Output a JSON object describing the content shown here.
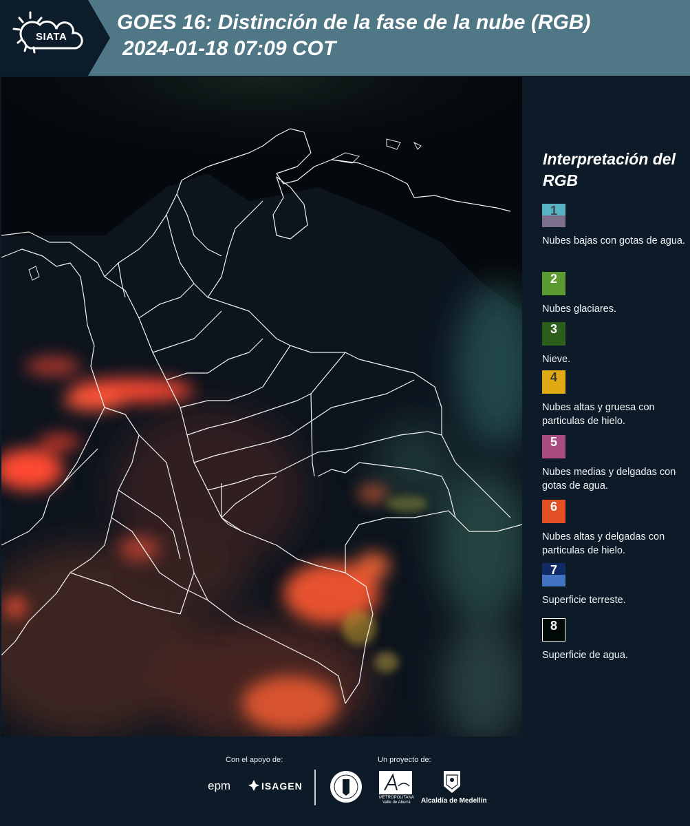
{
  "header": {
    "logo_text": "SIATA",
    "title": "GOES 16: Distinción de la fase de la nube (RGB)",
    "subtitle": "2024-01-18 07:09 COT"
  },
  "legend": {
    "title": "Interpretación del RGB",
    "items": [
      {
        "number": "1",
        "label": "Nubes bajas con gotas de agua.",
        "color_top": "#58b2c2",
        "color_bottom": "#7c6f8c",
        "text_color": "#3d4a55"
      },
      {
        "number": "2",
        "label": "Nubes glaciares.",
        "color_top": "#5b9a2e",
        "color_bottom": "#5b9a2e",
        "text_color": "#ffffff"
      },
      {
        "number": "3",
        "label": "Nieve.",
        "color_top": "#2d5e1c",
        "color_bottom": "#2d5e1c",
        "text_color": "#ffffff"
      },
      {
        "number": "4",
        "label": "Nubes altas y gruesa con particulas de hielo.",
        "color_top": "#e0aa14",
        "color_bottom": "#e0aa14",
        "text_color": "#3d3a2a"
      },
      {
        "number": "5",
        "label": "Nubes medias y delgadas con gotas de agua.",
        "color_top": "#a84c82",
        "color_bottom": "#a84c82",
        "text_color": "#ffffff"
      },
      {
        "number": "6",
        "label": "Nubes altas y delgadas con particulas de hielo.",
        "color_top": "#e24e26",
        "color_bottom": "#e24e26",
        "text_color": "#ffffff"
      },
      {
        "number": "7",
        "label": "Superficie terreste.",
        "color_top": "#102a66",
        "color_bottom": "#4473c2",
        "text_color": "#ffffff"
      },
      {
        "number": "8",
        "label": "Superficie de agua.",
        "color_top": "#020a06",
        "color_bottom": "#020a06",
        "text_color": "#ffffff"
      }
    ]
  },
  "footer": {
    "support_label": "Con el apoyo de:",
    "project_label": "Un proyecto de:",
    "epm_text": "epm",
    "isagen_text": "ISAGEN",
    "metro_text": "METROPOLITANA",
    "metro_sub": "Valle de Aburrá",
    "alcaldia_text": "Alcaldía de Medellín"
  }
}
